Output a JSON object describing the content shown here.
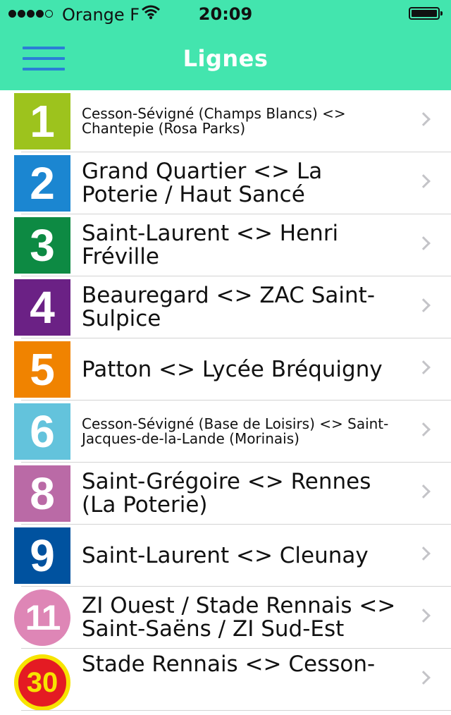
{
  "status_bar": {
    "carrier": "Orange F",
    "time": "20:09"
  },
  "header": {
    "title": "Lignes",
    "accent": "#43e5ae"
  },
  "lines": [
    {
      "number": "1",
      "color": "#9dc31d",
      "label": "Cesson-Sévigné (Champs Blancs) <> Chantepie (Rosa Parks)"
    },
    {
      "number": "2",
      "color": "#1b86d1",
      "label": "Grand Quartier <> La Poterie / Haut Sancé"
    },
    {
      "number": "3",
      "color": "#0d8a43",
      "label": "Saint-Laurent <> Henri Fréville"
    },
    {
      "number": "4",
      "color": "#6b2185",
      "label": "Beauregard <> ZAC Saint-Sulpice"
    },
    {
      "number": "5",
      "color": "#f08300",
      "label": "Patton <> Lycée Bréquigny"
    },
    {
      "number": "6",
      "color": "#63c3dc",
      "label": "Cesson-Sévigné (Base de Loisirs) <> Saint-Jacques-de-la-Lande (Morinais)"
    },
    {
      "number": "8",
      "color": "#ba6aa6",
      "label": "Saint-Grégoire <> Rennes (La Poterie)"
    },
    {
      "number": "9",
      "color": "#00529f",
      "label": "Saint-Laurent <> Cleunay"
    },
    {
      "number": "11",
      "color": "#de86b6",
      "label": "ZI Ouest / Stade Rennais <> Saint-Saëns / ZI Sud-Est"
    },
    {
      "number": "30",
      "color": "#e41b23",
      "label": "Stade Rennais <> Cesson-"
    }
  ]
}
